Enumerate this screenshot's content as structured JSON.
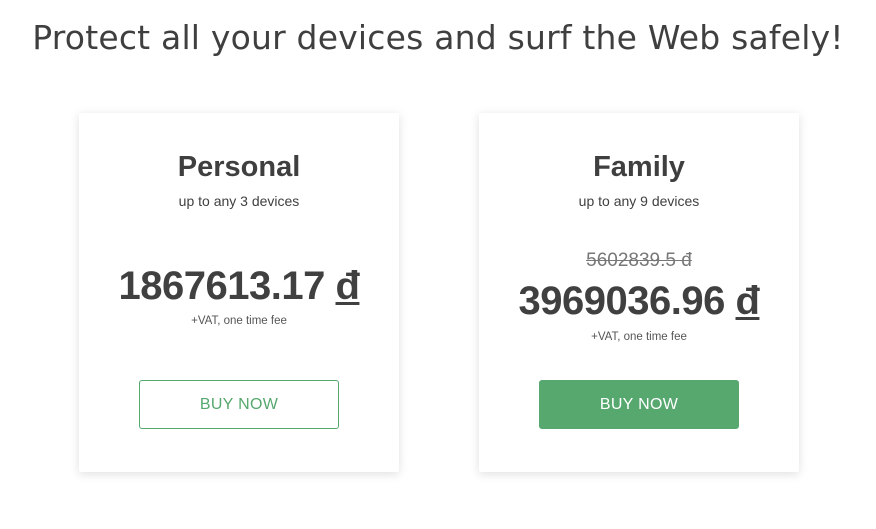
{
  "headline": "Protect all your devices and surf the Web safely!",
  "colors": {
    "accent": "#56a86f",
    "text": "#404040"
  },
  "plans": [
    {
      "name": "Personal",
      "devices": "up to any 3 devices",
      "price": "1867613.17",
      "currency": "đ",
      "fee_note": "+VAT, one time fee",
      "button_label": "BUY NOW"
    },
    {
      "name": "Family",
      "devices": "up to any 9 devices",
      "old_price": "5602839.5 đ",
      "price": "3969036.96",
      "currency": "đ",
      "fee_note": "+VAT, one time fee",
      "button_label": "BUY NOW"
    }
  ]
}
